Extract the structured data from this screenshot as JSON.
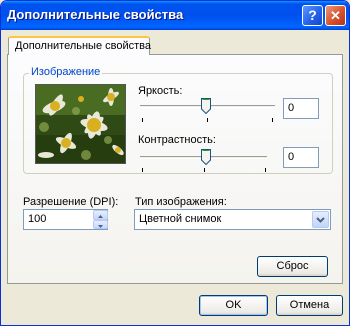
{
  "window": {
    "title": "Дополнительные свойства"
  },
  "tab": {
    "label": "Дополнительные свойства"
  },
  "image_group": {
    "legend": "Изображение"
  },
  "brightness": {
    "label": "Яркость:",
    "value": "0"
  },
  "contrast": {
    "label": "Контрастность:",
    "value": "0"
  },
  "resolution": {
    "label": "Разрешение (DPI):",
    "value": "100"
  },
  "image_type": {
    "label": "Тип изображения:",
    "selected": "Цветной снимок"
  },
  "buttons": {
    "reset": "Сброс",
    "ok": "OK",
    "cancel": "Отмена"
  },
  "colors": {
    "title_bar": "#0054E3",
    "accent": "#0046D5",
    "dialog_bg": "#ECE9D8"
  }
}
